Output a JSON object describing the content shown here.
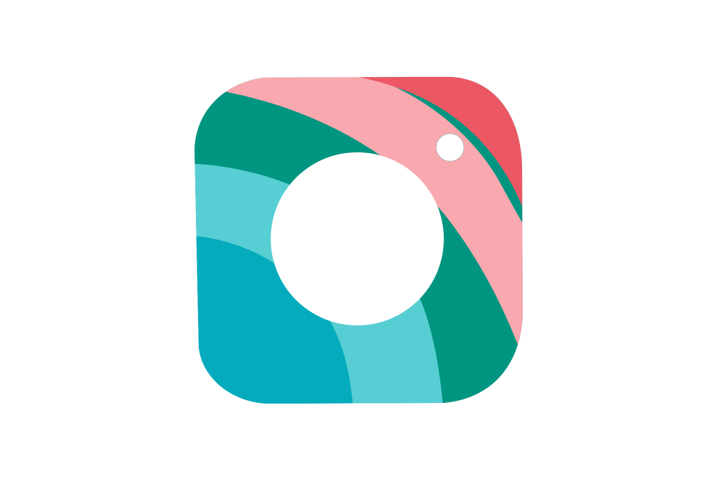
{
  "logo": {
    "icon": "camera-app-icon",
    "colors": {
      "background": "#ffffff",
      "deep_teal": "#009580",
      "light_cyan": "#57ced4",
      "cyan": "#04abbd",
      "light_pink": "#f8a8ae",
      "coral_red": "#ec5764",
      "lens": "#ffffff",
      "flash": "#ffffff"
    }
  }
}
